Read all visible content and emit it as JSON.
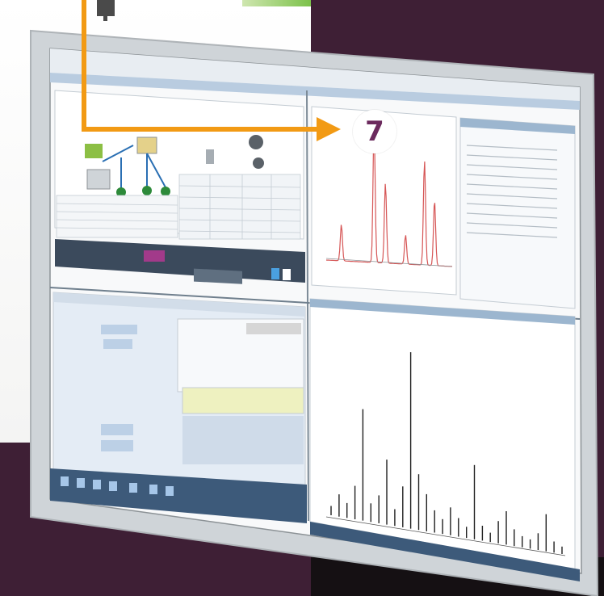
{
  "callout": {
    "number": "7",
    "color": "#f29a14",
    "badge_text_color": "#6b2a5d"
  },
  "background": {
    "color": "#3e1f35"
  },
  "monitor": {
    "app_title": "",
    "menu_items": [],
    "panels": {
      "top_left": "instrument-diagram",
      "top_middle": "chromatogram",
      "top_right": "results-list",
      "bottom_left": "method-parameters",
      "bottom_right": "mass-spectrum"
    }
  },
  "chromatogram": {
    "peaks": [
      {
        "x": 0.12,
        "h": 0.25
      },
      {
        "x": 0.38,
        "h": 0.95
      },
      {
        "x": 0.47,
        "h": 0.55
      },
      {
        "x": 0.63,
        "h": 0.2
      },
      {
        "x": 0.78,
        "h": 0.72
      },
      {
        "x": 0.86,
        "h": 0.45
      }
    ]
  },
  "spectrum": {
    "peaks": [
      0.05,
      0.12,
      0.08,
      0.18,
      0.6,
      0.1,
      0.15,
      0.35,
      0.09,
      0.22,
      0.95,
      0.3,
      0.2,
      0.12,
      0.08,
      0.15,
      0.1,
      0.06,
      0.4,
      0.08,
      0.05,
      0.12,
      0.18,
      0.09,
      0.06,
      0.05,
      0.09,
      0.2,
      0.06,
      0.04
    ]
  }
}
